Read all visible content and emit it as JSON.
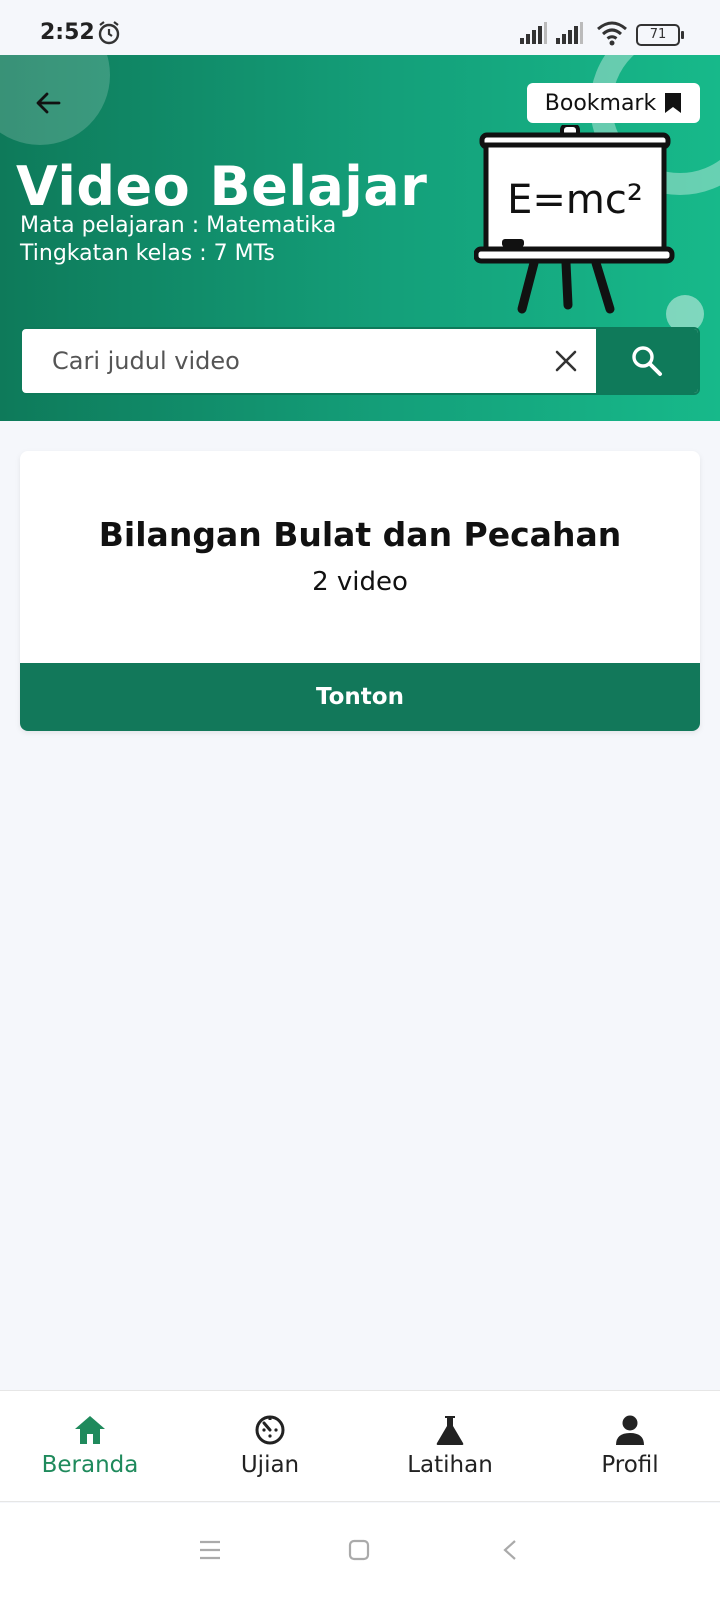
{
  "status_bar": {
    "time": "2:52",
    "battery": "71"
  },
  "header": {
    "bookmark_label": "Bookmark",
    "title": "Video Belajar",
    "subject": "Mata pelajaran : Matematika",
    "grade": "Tingkatan kelas : 7 MTs",
    "board_text": "E=mc²"
  },
  "search": {
    "placeholder": "Cari judul video"
  },
  "cards": [
    {
      "title": "Bilangan Bulat dan Pecahan",
      "count": "2 video",
      "action_label": "Tonton"
    }
  ],
  "bottom_nav": {
    "items": [
      {
        "label": "Beranda",
        "icon": "home-icon",
        "active": true
      },
      {
        "label": "Ujian",
        "icon": "timer-icon",
        "active": false
      },
      {
        "label": "Latihan",
        "icon": "flask-icon",
        "active": false
      },
      {
        "label": "Profil",
        "icon": "person-icon",
        "active": false
      }
    ]
  },
  "colors": {
    "primary": "#12785a",
    "accent_active": "#1f8a5c",
    "background": "#f5f7fb"
  }
}
